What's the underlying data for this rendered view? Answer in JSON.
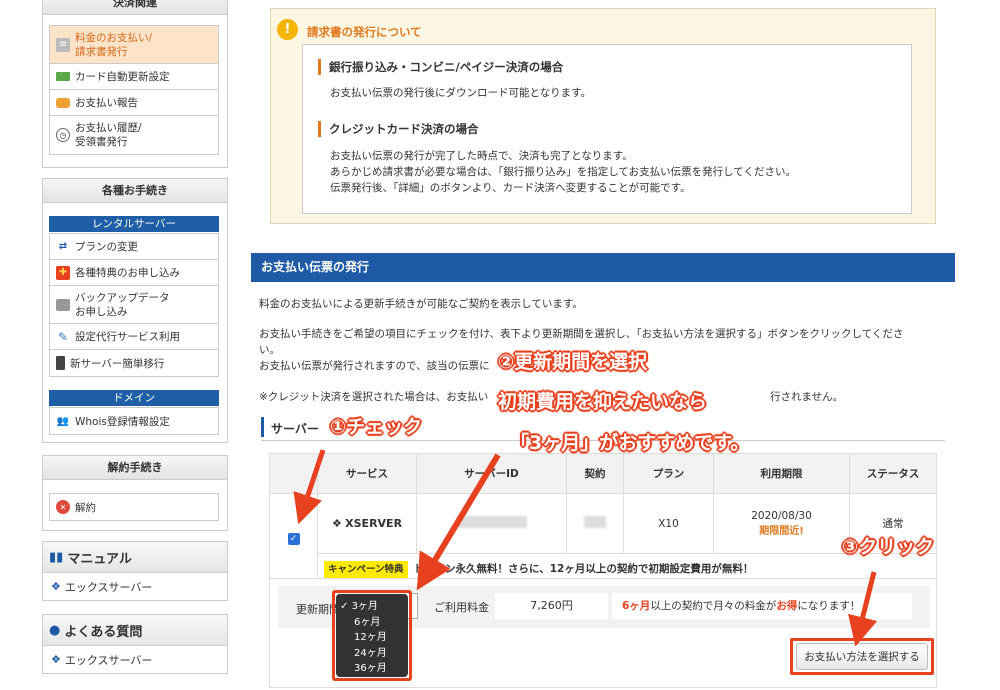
{
  "sidebar": {
    "payment_head": "決済関連",
    "payment_items": [
      "料金のお支払い/\n請求書発行",
      "カード自動更新設定",
      "お支払い報告",
      "お支払い履歴/\n受領書発行"
    ],
    "procedures_head": "各種お手続き",
    "rental_band": "レンタルサーバー",
    "rental_items": [
      "プランの変更",
      "各種特典のお申し込み",
      "バックアップデータ\nお申し込み",
      "設定代行サービス利用",
      "新サーバー簡単移行"
    ],
    "domain_band": "ドメイン",
    "domain_items": [
      "Whois登録情報設定"
    ],
    "cancel_head": "解約手続き",
    "cancel_item": "解約",
    "manual_head": "マニュアル",
    "manual_item": "エックスサーバー",
    "faq_head": "よくある質問",
    "faq_item": "エックスサーバー"
  },
  "notice": {
    "title": "請求書の発行について",
    "bank_title": "銀行振り込み・コンビニ/ペイジー決済の場合",
    "bank_text": "お支払い伝票の発行後にダウンロード可能となります。",
    "card_title": "クレジットカード決済の場合",
    "card_lines": [
      "お支払い伝票の発行が完了した時点で、決済も完了となります。",
      "あらかじめ請求書が必要な場合は、「銀行振り込み」を指定してお支払い伝票を発行してください。",
      "伝票発行後、「詳細」のボタンより、カード決済へ変更することが可能です。"
    ]
  },
  "main": {
    "bar_title": "お支払い伝票の発行",
    "p1": "料金のお支払いによる更新手続きが可能なご契約を表示しています。",
    "p2a": "お支払い手続きをご希望の項目にチェックを付け、表下より更新期間を選択し、「お支払い方法を選択する」ボタンをクリックしてくださ",
    "p2b": "い。",
    "p3": "お支払い伝票が発行されますので、該当の伝票に",
    "p4a": "※クレジット決済を選択された場合は、お支払い",
    "p4b": "行されません。",
    "server_head": "サーバー",
    "table_headers": [
      "",
      "サービス",
      "サーバーID",
      "契約",
      "プラン",
      "利用期限",
      "ステータス"
    ],
    "row": {
      "service": "XSERVER",
      "plan": "X10",
      "expiry": "2020/08/30",
      "expiry_note": "期限間近!",
      "status": "通常"
    },
    "campaign_badge": "キャンペーン特典",
    "campaign_text": "ドメイン永久無料！さらに、12ヶ月以上の契約で初期設定費用が無料！",
    "period_label": "更新期間",
    "period_options": [
      "3ヶ月",
      "6ヶ月",
      "12ヶ月",
      "24ヶ月",
      "36ヶ月"
    ],
    "period_selected": "3ヶ月",
    "fee_label": "ご利用料金",
    "fee_value": "7,260円",
    "promo_pre": "6ヶ月",
    "promo_mid": "以上の契約で月々の料金が",
    "promo_em": "お得",
    "promo_post": "になります！",
    "pay_button": "お支払い方法を選択する"
  },
  "annotations": {
    "a1": "①チェック",
    "a2": "②更新期間を選択",
    "a2b": "初期費用を抑えたいなら",
    "a2c": "「3ヶ月」がおすすめです。",
    "a3": "③クリック"
  },
  "colors": {
    "accent": "#e8411f",
    "blue": "#1e5aa6",
    "orange": "#e07a1f"
  }
}
